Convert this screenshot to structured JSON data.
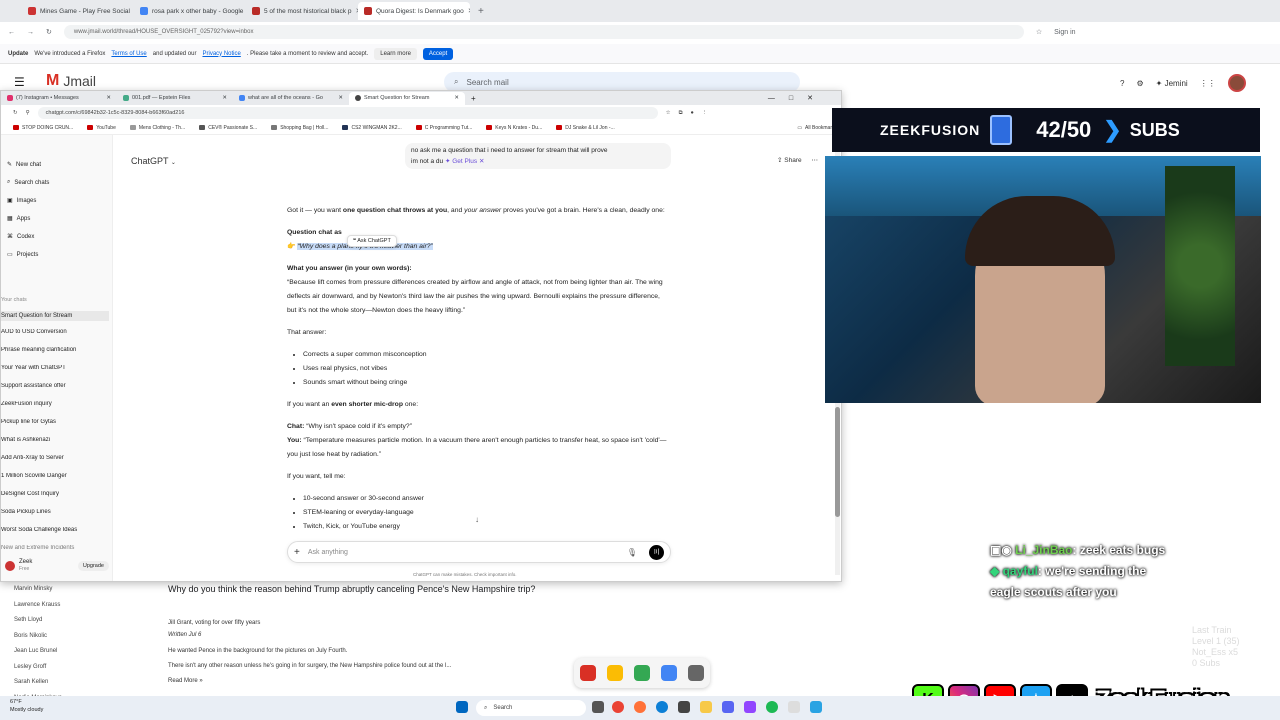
{
  "outer_browser": {
    "tabs": [
      {
        "label": "Mines Game - Play Free Social"
      },
      {
        "label": "rosa park x other baby - Google"
      },
      {
        "label": "5 of the most historical black p"
      },
      {
        "label": "Quora Digest: Is Denmark goo",
        "active": true
      }
    ],
    "url": "www.jmail.world/thread/HOUSE_OVERSIGHT_025792?view=inbox",
    "signin": "Sign in"
  },
  "notice": {
    "text_a": "Update",
    "text_b": "We've introduced a Firefox",
    "terms": "Terms of Use",
    "text_c": "and updated our",
    "privacy": "Privacy Notice",
    "text_d": ". Please take a moment to review and accept.",
    "learn": "Learn more",
    "accept": "Accept"
  },
  "jmail": {
    "logo": "Jmail",
    "search_placeholder": "Search mail",
    "jemini": "Jemini",
    "senders": [
      "Marvin Minsky",
      "Lawrence Krauss",
      "Seth Lloyd",
      "Boris Nikolic",
      "Jean Luc Brunel",
      "Lesley Groff",
      "Sarah Kellen",
      "Nadia Marcinkova"
    ],
    "question": "Why do you think the reason behind Trump abruptly canceling Pence's New Hampshire trip?",
    "author": "Jill Grant, voting for over fifty years",
    "written": "Written Jul 6",
    "body1": "He wanted Pence in the background for the pictures on July Fourth.",
    "body2": "There isn't any other reason unless he's going in for surgery, the New Hampshire police found out at the l...",
    "read_more": "Read More »"
  },
  "inner_browser": {
    "tabs": [
      {
        "label": "(7) Instagram • Messages"
      },
      {
        "label": "001.pdf — Epstein Files"
      },
      {
        "label": "what are all of the oceans - Go"
      },
      {
        "label": "Smart Question for Stream",
        "active": true
      }
    ],
    "url": "chatgpt.com/c/69842b32-1c5c-8329-8084-b663f60ad216",
    "bookmarks": [
      "STOP DOING CRUN...",
      "YouTube",
      "Mens Clothing - Th...",
      "CEV® Passionate S...",
      "Shopping Bag | Holl...",
      "CS2 WINGMAN 2K2...",
      "C Programming Tut...",
      "Keys N Krates - Du...",
      "DJ Snake & Lil Jon -..."
    ],
    "all_bookmarks": "All Bookmarks"
  },
  "sidebar": {
    "new_chat": "New chat",
    "search": "Search chats",
    "images": "Images",
    "apps": "Apps",
    "codex": "Codex",
    "projects": "Projects",
    "your_chats": "Your chats",
    "chats": [
      "Smart Question for Stream",
      "AUD to USD Conversion",
      "Phrase meaning clarification",
      "Your Year with ChatGPT",
      "Support assistance offer",
      "ZeekFusion inquiry",
      "Pickup line for Gytas",
      "What is Ashkenazi",
      "Add Anti-Xray to Server",
      "1 Million Scoville Danger",
      "DeSignel Cost Inquiry",
      "Soda Pickup Lines",
      "Worst Soda Challenge Ideas",
      "New and Extreme Incidents"
    ],
    "user_name": "Zeek",
    "user_plan": "Free",
    "upgrade": "Upgrade"
  },
  "chat": {
    "title": "ChatGPT",
    "share": "Share",
    "user_msg_1": "no ask me a question that i need to answer for stream that will prove",
    "user_msg_2": "im not a du",
    "get_plus": "Get Plus",
    "intro_a": "Got it — you want ",
    "intro_b": "one question chat throws at you",
    "intro_c": ", and ",
    "intro_d": "your answer",
    "intro_e": " proves you've got a brain. Here's a clean, deadly one:",
    "qlabel": "Question chat as",
    "ask_popup": "Ask ChatGPT",
    "question": "“Why does a plane fly if it's heavier than air?”",
    "answer_label": "What you answer (in your own words):",
    "answer_text": "“Because lift comes from pressure differences created by airflow and angle of attack, not from being lighter than air. The wing deflects air downward, and by Newton's third law the air pushes the wing upward. Bernoulli explains the pressure difference, but it's not the whole story—Newton does the heavy lifting.”",
    "that_answer": "That answer:",
    "bullets1": [
      "Corrects a super common misconception",
      "Uses real physics, not vibes",
      "Sounds smart without being cringe"
    ],
    "shorter_a": "If you want an ",
    "shorter_b": "even shorter mic-drop",
    "shorter_c": " one:",
    "chat_label": "Chat:",
    "chat_q": " “Why isn't space cold if it's empty?”",
    "you_label": "You:",
    "you_a": " “Temperature measures particle motion. In a vacuum there aren't enough particles to transfer heat, so space isn't 'cold'—you just lose heat by radiation.”",
    "tell_me": "If you want, tell me:",
    "bullets2": [
      "10-second answer or 30-second answer",
      "STEM-leaning or everyday-language",
      "Twitch, Kick, or YouTube energy"
    ],
    "composer_placeholder": "Ask anything",
    "disclaimer": "ChatGPT can make mistakes. Check important info."
  },
  "stream": {
    "brand": "ZEEKFUSION",
    "sub_count": "42/50",
    "sub_label": "SUBS",
    "chat": [
      {
        "user": "Li_JinBao",
        "msg": ": zeek eats bugs"
      },
      {
        "user": "qayful",
        "msg": ": we're sending the eagle scouts after you"
      }
    ],
    "last_train_1": "Last Train",
    "last_train_2": "Level 1 (35)",
    "last_train_3": "Not_Ess x5",
    "last_train_4": "0 Subs",
    "handle": "ZeekFusion"
  },
  "taskbar": {
    "temp": "67°F",
    "weather": "Mostly cloudy",
    "search": "Search"
  }
}
